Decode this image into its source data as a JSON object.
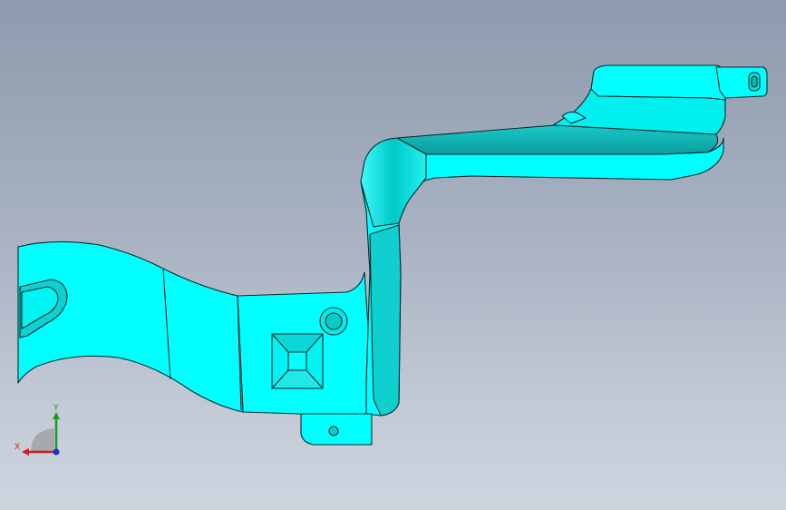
{
  "viewport": {
    "background_top": "#8e9bae",
    "background_bottom": "#cfd5df",
    "model": {
      "name": "sheet-metal-bracket",
      "face_color": "#00ffff",
      "edge_color": "#0b2a2a"
    }
  },
  "triad": {
    "x_label": "X",
    "y_label": "Y",
    "x_color": "#d11a1a",
    "y_color": "#1b9a2c",
    "z_color": "#1a2fd1"
  }
}
